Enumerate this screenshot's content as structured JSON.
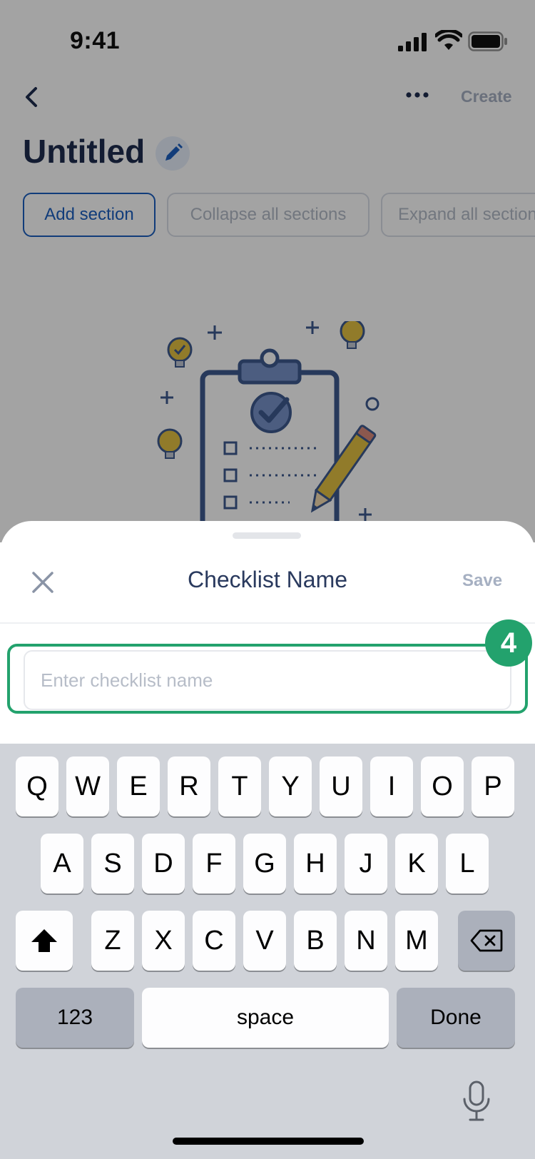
{
  "status_bar": {
    "time": "9:41"
  },
  "nav": {
    "create_label": "Create"
  },
  "page": {
    "title": "Untitled"
  },
  "chips": [
    {
      "label": "Add section"
    },
    {
      "label": "Collapse all sections"
    },
    {
      "label": "Expand all sections"
    }
  ],
  "sheet": {
    "title": "Checklist Name",
    "save_label": "Save",
    "input_placeholder": "Enter checklist name",
    "step_badge": "4"
  },
  "keyboard": {
    "row1": [
      "Q",
      "W",
      "E",
      "R",
      "T",
      "Y",
      "U",
      "I",
      "O",
      "P"
    ],
    "row2": [
      "A",
      "S",
      "D",
      "F",
      "G",
      "H",
      "J",
      "K",
      "L"
    ],
    "row3": [
      "Z",
      "X",
      "C",
      "V",
      "B",
      "N",
      "M"
    ],
    "numbers_label": "123",
    "space_label": "space",
    "done_label": "Done"
  },
  "colors": {
    "accent": "#1b5fbf",
    "highlight": "#23a26d",
    "title": "#1e2d4f"
  }
}
